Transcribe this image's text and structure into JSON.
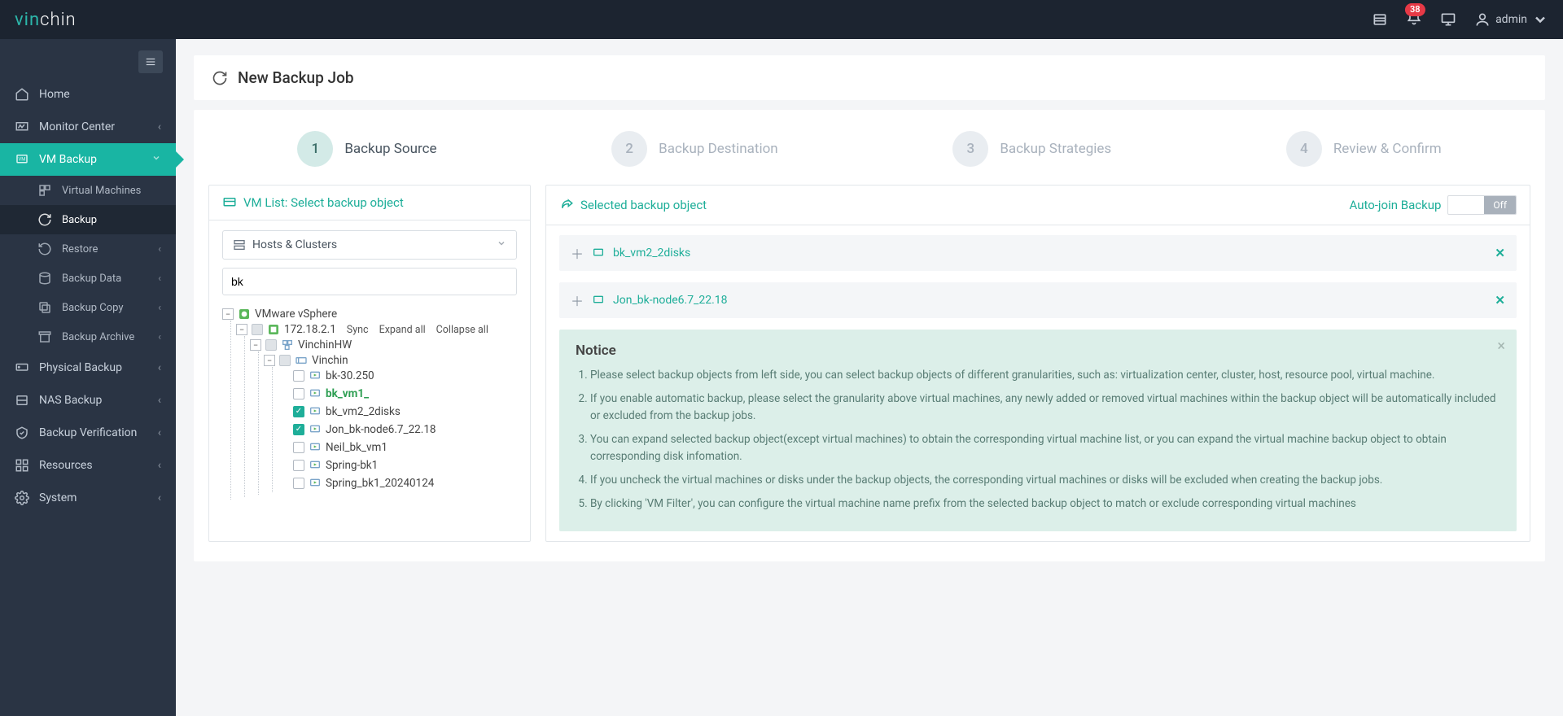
{
  "brand": {
    "p1": "vin",
    "p2": "chin"
  },
  "topbar": {
    "badge": "38",
    "user": "admin"
  },
  "sidebar": {
    "home": "Home",
    "monitor": "Monitor Center",
    "vmbackup": "VM Backup",
    "sub": {
      "vms": "Virtual Machines",
      "backup": "Backup",
      "restore": "Restore",
      "backupdata": "Backup Data",
      "backupcopy": "Backup Copy",
      "backuparchive": "Backup Archive"
    },
    "physical": "Physical Backup",
    "nas": "NAS Backup",
    "verify": "Backup Verification",
    "resources": "Resources",
    "system": "System"
  },
  "page": {
    "title": "New Backup Job"
  },
  "steps": {
    "s1": "Backup Source",
    "s2": "Backup Destination",
    "s3": "Backup Strategies",
    "s4": "Review & Confirm",
    "n1": "1",
    "n2": "2",
    "n3": "3",
    "n4": "4"
  },
  "left": {
    "title": "VM List: Select backup object",
    "select": "Hosts & Clusters",
    "search": "bk",
    "actions": {
      "sync": "Sync",
      "expand": "Expand all",
      "collapse": "Collapse all"
    },
    "tree": {
      "root": "VMware vSphere",
      "host": "172.18.2.1",
      "cluster": "VinchinHW",
      "pool": "Vinchin",
      "vms": {
        "v1": "bk-30.250",
        "v2": "bk_vm1_",
        "v3": "bk_vm2_2disks",
        "v4": "Jon_bk-node6.7_22.18",
        "v5": "Neil_bk_vm1",
        "v6": "Spring-bk1",
        "v7": "Spring_bk1_20240124"
      }
    }
  },
  "right": {
    "title": "Selected backup object",
    "autojoin": "Auto-join Backup",
    "off": "Off",
    "items": {
      "i1": "bk_vm2_2disks",
      "i2": "Jon_bk-node6.7_22.18"
    },
    "notice": {
      "title": "Notice",
      "n1": "Please select backup objects from left side, you can select backup objects of different granularities, such as: virtualization center, cluster, host, resource pool, virtual machine.",
      "n2": "If you enable automatic backup, please select the granularity above virtual machines, any newly added or removed virtual machines within the backup object will be automatically included or excluded from the backup jobs.",
      "n3": "You can expand selected backup object(except virtual machines) to obtain the corresponding virtual machine list, or you can expand the virtual machine backup object to obtain corresponding disk infomation.",
      "n4": "If you uncheck the virtual machines or disks under the backup objects, the corresponding virtual machines or disks will be excluded when creating the backup jobs.",
      "n5": "By clicking 'VM Filter', you can configure the virtual machine name prefix from the selected backup object to match or exclude corresponding virtual machines"
    }
  }
}
